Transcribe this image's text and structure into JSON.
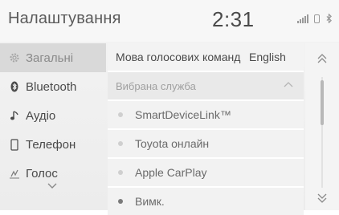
{
  "header": {
    "title": "Налаштування",
    "clock": "2:31",
    "icons": [
      "signal-icon",
      "phone-icon",
      "bluetooth-icon"
    ]
  },
  "sidebar": {
    "items": [
      {
        "label": "Загальні",
        "icon": "gear-icon",
        "active": true
      },
      {
        "label": "Bluetooth",
        "icon": "bluetooth-icon",
        "active": false
      },
      {
        "label": "Аудіо",
        "icon": "music-note-icon",
        "active": false
      },
      {
        "label": "Телефон",
        "icon": "phone-icon",
        "active": false
      },
      {
        "label": "Голос",
        "icon": "voice-icon",
        "active": false
      }
    ],
    "more_icon": "chevron-down-icon"
  },
  "main": {
    "voice_language": {
      "label": "Мова голосових команд",
      "value": "English"
    },
    "service_group": {
      "label": "Вибрана служба",
      "expanded": true
    },
    "options": [
      {
        "label": "SmartDeviceLink™",
        "selected": false
      },
      {
        "label": "Toyota онлайн",
        "selected": false
      },
      {
        "label": "Apple CarPlay",
        "selected": false
      },
      {
        "label": "Вимк.",
        "selected": true
      }
    ]
  },
  "scroll": {
    "up_icon": "double-chevron-up-icon",
    "down_icon": "double-chevron-down-icon"
  },
  "colors": {
    "active_bg": "#d9d9d9",
    "selected_dot": "#7a7a7a"
  }
}
